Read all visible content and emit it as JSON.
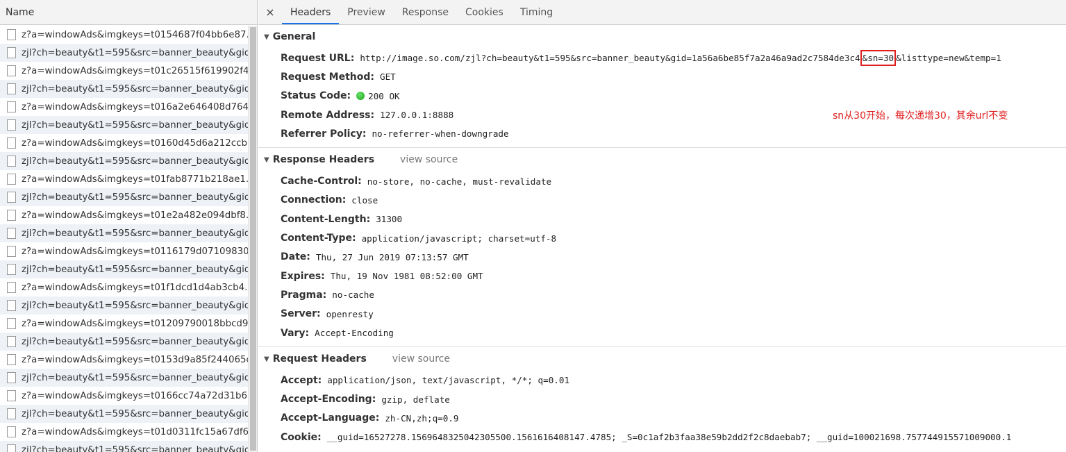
{
  "left": {
    "header": "Name",
    "requests": [
      "z?a=windowAds&imgkeys=t0154687f04bb6e87...",
      "zjl?ch=beauty&t1=595&src=banner_beauty&gid",
      "z?a=windowAds&imgkeys=t01c26515f619902f4...",
      "zjl?ch=beauty&t1=595&src=banner_beauty&gid",
      "z?a=windowAds&imgkeys=t016a2e646408d764...",
      "zjl?ch=beauty&t1=595&src=banner_beauty&gid",
      "z?a=windowAds&imgkeys=t0160d45d6a212ccb...",
      "zjl?ch=beauty&t1=595&src=banner_beauty&gid",
      "z?a=windowAds&imgkeys=t01fab8771b218ae1...",
      "zjl?ch=beauty&t1=595&src=banner_beauty&gid",
      "z?a=windowAds&imgkeys=t01e2a482e094dbf8...",
      "zjl?ch=beauty&t1=595&src=banner_beauty&gid",
      "z?a=windowAds&imgkeys=t0116179d07109830...",
      "zjl?ch=beauty&t1=595&src=banner_beauty&gid",
      "z?a=windowAds&imgkeys=t01f1dcd1d4ab3cb4...",
      "zjl?ch=beauty&t1=595&src=banner_beauty&gid",
      "z?a=windowAds&imgkeys=t01209790018bbcd9...",
      "zjl?ch=beauty&t1=595&src=banner_beauty&gid",
      "z?a=windowAds&imgkeys=t0153d9a85f244065c",
      "zjl?ch=beauty&t1=595&src=banner_beauty&gid",
      "z?a=windowAds&imgkeys=t0166cc74a72d31b6...",
      "zjl?ch=beauty&t1=595&src=banner_beauty&gid",
      "z?a=windowAds&imgkeys=t01d0311fc15a67df6...",
      "zjl?ch=beauty&t1=595&src=banner_beauty&gid"
    ]
  },
  "tabs": {
    "close": "×",
    "items": [
      "Headers",
      "Preview",
      "Response",
      "Cookies",
      "Timing"
    ]
  },
  "general": {
    "title": "General",
    "request_url_label": "Request URL:",
    "request_url_prefix": "http://image.so.com/zjl?ch=beauty&t1=595&src=banner_beauty&gid=1a56a6be85f7a2a46a9ad2c7584de3c4",
    "request_url_highlight": "&sn=30",
    "request_url_suffix": "&listtype=new&temp=1",
    "method_label": "Request Method:",
    "method": "GET",
    "status_label": "Status Code:",
    "status": "200 OK",
    "remote_label": "Remote Address:",
    "remote": "127.0.0.1:8888",
    "referrer_label": "Referrer Policy:",
    "referrer": "no-referrer-when-downgrade"
  },
  "annotation": "sn从30开始，每次递增30，其余url不变",
  "response_headers": {
    "title": "Response Headers",
    "view_source": "view source",
    "items": [
      {
        "k": "Cache-Control:",
        "v": "no-store, no-cache, must-revalidate"
      },
      {
        "k": "Connection:",
        "v": "close"
      },
      {
        "k": "Content-Length:",
        "v": "31300"
      },
      {
        "k": "Content-Type:",
        "v": "application/javascript; charset=utf-8"
      },
      {
        "k": "Date:",
        "v": "Thu, 27 Jun 2019 07:13:57 GMT"
      },
      {
        "k": "Expires:",
        "v": "Thu, 19 Nov 1981 08:52:00 GMT"
      },
      {
        "k": "Pragma:",
        "v": "no-cache"
      },
      {
        "k": "Server:",
        "v": "openresty"
      },
      {
        "k": "Vary:",
        "v": "Accept-Encoding"
      }
    ]
  },
  "request_headers": {
    "title": "Request Headers",
    "view_source": "view source",
    "items": [
      {
        "k": "Accept:",
        "v": "application/json, text/javascript, */*; q=0.01"
      },
      {
        "k": "Accept-Encoding:",
        "v": "gzip, deflate"
      },
      {
        "k": "Accept-Language:",
        "v": "zh-CN,zh;q=0.9"
      },
      {
        "k": "Cookie:",
        "v": "__guid=16527278.1569648325042305500.1561616408147.4785; _S=0c1af2b3faa38e59b2dd2f2c8daebab7; __guid=100021698.757744915571009000.1"
      }
    ]
  }
}
